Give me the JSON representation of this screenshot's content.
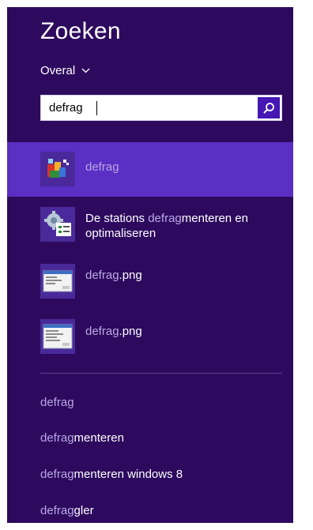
{
  "pane": {
    "title": "Zoeken",
    "scope": "Overal",
    "search": {
      "value": "defrag",
      "placeholder": ""
    }
  },
  "results": [
    {
      "match": "defrag",
      "rest": "",
      "icon": "defrag-app-icon",
      "selected": true
    },
    {
      "pre": "De stations ",
      "match": "defrag",
      "rest": "menteren en",
      "line2": "optimaliseren",
      "icon": "optimize-drives-icon"
    },
    {
      "match": "defrag",
      "rest": ".png",
      "icon": "png-file-icon"
    },
    {
      "match": "defrag",
      "rest": ".png",
      "icon": "png-file-icon"
    }
  ],
  "suggestions": [
    {
      "match": "defrag",
      "rest": ""
    },
    {
      "match": "defrag",
      "rest": "menteren"
    },
    {
      "match": "defrag",
      "rest": "menteren windows 8"
    },
    {
      "match": "defrag",
      "rest": "gler"
    }
  ],
  "colors": {
    "pane": "#2d0a5e",
    "selected": "#5a2fc4",
    "accent": "#4617b4",
    "match": "#b9a8e6"
  }
}
